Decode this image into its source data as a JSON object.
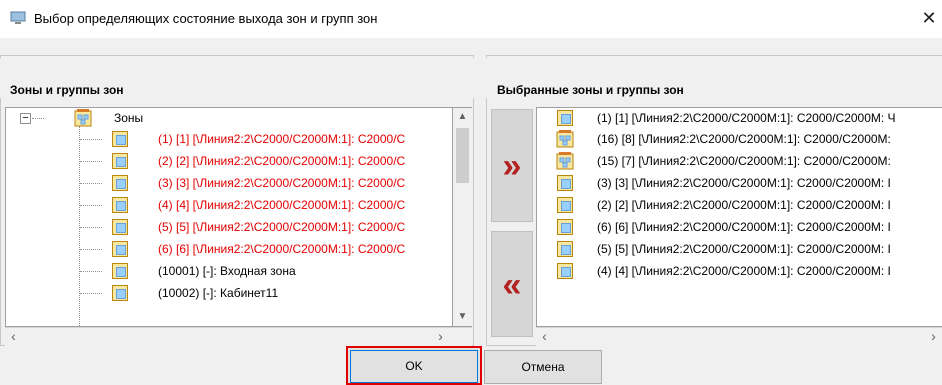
{
  "window": {
    "title": "Выбор определяющих состояние выхода зон и групп зон",
    "close_glyph": "✕"
  },
  "left_panel": {
    "header": "Зоны и группы зон",
    "tree_root": {
      "label": "Зоны",
      "icon": "zone-group-icon"
    },
    "items": [
      {
        "label": "(1) [1] [\\Линия2:2\\C2000/C2000M:1]: C2000/C",
        "status": "red"
      },
      {
        "label": "(2) [2] [\\Линия2:2\\C2000/C2000M:1]: C2000/C",
        "status": "red"
      },
      {
        "label": "(3) [3] [\\Линия2:2\\C2000/C2000M:1]: C2000/C",
        "status": "red"
      },
      {
        "label": "(4) [4] [\\Линия2:2\\C2000/C2000M:1]: C2000/C",
        "status": "red"
      },
      {
        "label": "(5) [5] [\\Линия2:2\\C2000/C2000M:1]: C2000/C",
        "status": "red"
      },
      {
        "label": "(6) [6] [\\Линия2:2\\C2000/C2000M:1]: C2000/C",
        "status": "red"
      },
      {
        "label": "(10001) [-]: Входная зона",
        "status": "normal"
      },
      {
        "label": "(10002) [-]: Кабинет11",
        "status": "normal"
      }
    ]
  },
  "right_panel": {
    "header": "Выбранные зоны и группы зон",
    "items": [
      {
        "label": "(1) [1] [\\Линия2:2\\C2000/C2000M:1]: C2000/C2000M: Ч",
        "icon": "zone-icon"
      },
      {
        "label": "(16) [8] [\\Линия2:2\\C2000/C2000M:1]: C2000/C2000M:",
        "icon": "zone-group-icon"
      },
      {
        "label": "(15) [7] [\\Линия2:2\\C2000/C2000M:1]: C2000/C2000M:",
        "icon": "zone-group-icon"
      },
      {
        "label": "(3) [3] [\\Линия2:2\\C2000/C2000M:1]: C2000/C2000M: I",
        "icon": "zone-icon"
      },
      {
        "label": "(2) [2] [\\Линия2:2\\C2000/C2000M:1]: C2000/C2000M: I",
        "icon": "zone-icon"
      },
      {
        "label": "(6) [6] [\\Линия2:2\\C2000/C2000M:1]: C2000/C2000M: I",
        "icon": "zone-icon"
      },
      {
        "label": "(5) [5] [\\Линия2:2\\C2000/C2000M:1]: C2000/C2000M: I",
        "icon": "zone-icon"
      },
      {
        "label": "(4) [4] [\\Линия2:2\\C2000/C2000M:1]: C2000/C2000M: I",
        "icon": "zone-icon"
      }
    ]
  },
  "buttons": {
    "move_right": "»",
    "move_left": "«",
    "ok": "OK",
    "cancel": "Отмена"
  },
  "colors": {
    "error_text": "#e60000",
    "arrow": "#b22222",
    "highlight_border": "#e00000"
  }
}
